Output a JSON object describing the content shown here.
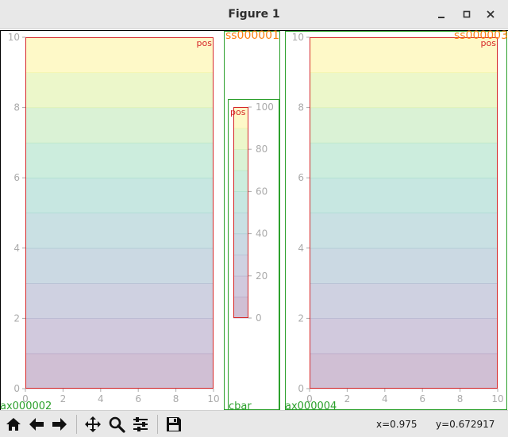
{
  "window": {
    "title": "Figure 1",
    "minimize_icon": "minimize-icon",
    "maximize_icon": "maximize-icon",
    "close_icon": "close-icon"
  },
  "figure": {
    "labels": {
      "ax1": "ax000002",
      "ax2": "ax000004",
      "cbar": "cbar",
      "ss1": "ss000001",
      "ss2": "ss000003",
      "pos": "pos"
    },
    "colors": {
      "axes_label": "#2ca02c",
      "subplotspec_label": "#ff7f0e",
      "pos_box": "#d62728",
      "tick": "#aaaaaa"
    }
  },
  "chart_data": [
    {
      "type": "heatmap",
      "name": "left-axes",
      "xlim": [
        0,
        10
      ],
      "ylim": [
        0,
        10
      ],
      "x_ticks": [
        0,
        2,
        4,
        6,
        8,
        10
      ],
      "y_ticks": [
        0,
        2,
        4,
        6,
        8,
        10
      ],
      "row_levels": [
        0,
        10,
        20,
        30,
        40,
        50,
        60,
        70,
        80,
        90
      ],
      "colormap": "viridis",
      "alpha": 0.25
    },
    {
      "type": "heatmap",
      "name": "right-axes",
      "xlim": [
        0,
        10
      ],
      "ylim": [
        0,
        10
      ],
      "x_ticks": [
        0,
        2,
        4,
        6,
        8,
        10
      ],
      "y_ticks": [
        0,
        2,
        4,
        6,
        8,
        10
      ],
      "row_levels": [
        0,
        10,
        20,
        30,
        40,
        50,
        60,
        70,
        80,
        90
      ],
      "colormap": "viridis",
      "alpha": 0.25
    },
    {
      "type": "colorbar",
      "name": "cbar",
      "range": [
        0,
        100
      ],
      "ticks": [
        0,
        20,
        40,
        60,
        80,
        100
      ]
    }
  ],
  "toolbar": {
    "buttons": [
      {
        "name": "home-button",
        "icon": "home-icon"
      },
      {
        "name": "back-button",
        "icon": "back-arrow-icon"
      },
      {
        "name": "forward-button",
        "icon": "forward-arrow-icon"
      },
      {
        "name": "pan-button",
        "icon": "move-icon"
      },
      {
        "name": "zoom-button",
        "icon": "zoom-icon"
      },
      {
        "name": "configure-subplots-button",
        "icon": "sliders-icon"
      },
      {
        "name": "save-button",
        "icon": "save-icon"
      }
    ],
    "x_readout": "x=0.975",
    "y_readout": "y=0.672917"
  }
}
